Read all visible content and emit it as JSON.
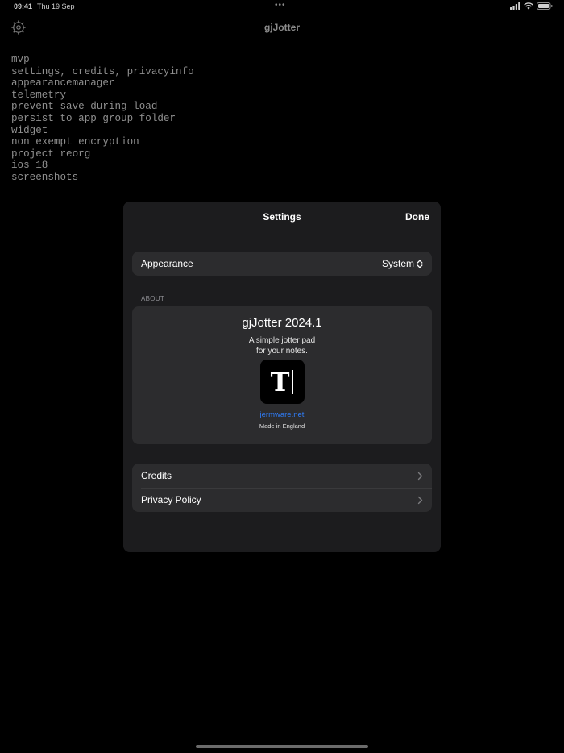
{
  "status_bar": {
    "time": "09:41",
    "date": "Thu 19 Sep",
    "multitask_dots": "•••",
    "icons": [
      "signal-icon",
      "wifi-icon",
      "battery-icon"
    ]
  },
  "app": {
    "title": "gjJotter",
    "settings_icon": "gear-icon"
  },
  "note": {
    "lines": [
      "mvp",
      "settings, credits, privacyinfo",
      "appearancemanager",
      "telemetry",
      "prevent save during load",
      "persist to app group folder",
      "widget",
      "non exempt encryption",
      "project reorg",
      "ios 18",
      "screenshots"
    ]
  },
  "settings": {
    "title": "Settings",
    "done_label": "Done",
    "appearance": {
      "label": "Appearance",
      "value": "System",
      "icon": "chevron-up-down-icon"
    },
    "about_header": "ABOUT",
    "about": {
      "app_name": "gjJotter 2024.1",
      "description_line1": "A simple jotter pad",
      "description_line2": "for your notes.",
      "icon_letter": "T",
      "website": "jermware.net",
      "made_in": "Made in England"
    },
    "links": [
      {
        "label": "Credits",
        "icon": "chevron-right-icon"
      },
      {
        "label": "Privacy Policy",
        "icon": "chevron-right-icon"
      }
    ]
  },
  "colors": {
    "background": "#000000",
    "modal": "#1c1c1e",
    "group": "#2c2c2e",
    "link": "#2f7cf6",
    "dimmed_text": "#8f8f8f"
  }
}
